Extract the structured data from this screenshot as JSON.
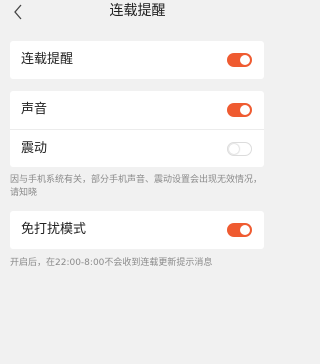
{
  "header": {
    "back_icon": "chevron-left-icon",
    "title": "连载提醒"
  },
  "section1": {
    "rows": [
      {
        "label": "连载提醒",
        "enabled": true
      }
    ]
  },
  "section2": {
    "rows": [
      {
        "label": "声音",
        "enabled": true
      },
      {
        "label": "震动",
        "enabled": false
      }
    ],
    "note": "因与手机系统有关，部分手机声音、震动设置会出现无效情况，请知晓"
  },
  "section3": {
    "rows": [
      {
        "label": "免打扰模式",
        "enabled": true
      }
    ],
    "note": "开启后，在22:00-8:00不会收到连载更新提示消息"
  },
  "colors": {
    "accent": "#ef5b31",
    "background": "#f1f1f1",
    "card": "#ffffff"
  }
}
